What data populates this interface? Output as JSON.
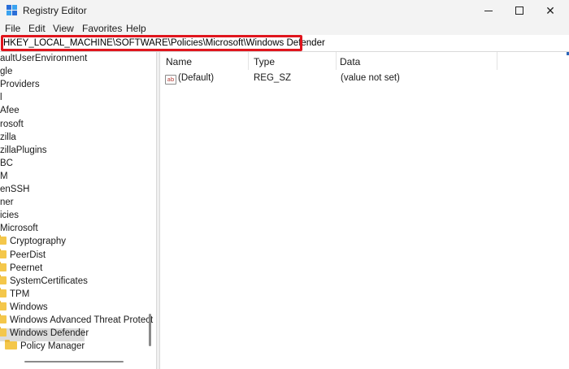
{
  "window": {
    "title": "Registry Editor",
    "minimize_glyph": "",
    "close_glyph": "✕"
  },
  "menu": [
    "File",
    "Edit",
    "View",
    "Favorites",
    "Help"
  ],
  "address": {
    "path": "HKEY_LOCAL_MACHINE\\SOFTWARE\\Policies\\Microsoft\\Windows Defender"
  },
  "tree": {
    "items": [
      {
        "label": "aultUserEnvironment",
        "folder": false
      },
      {
        "label": "gle",
        "folder": false
      },
      {
        "label": "Providers",
        "folder": false
      },
      {
        "label": "l",
        "folder": false
      },
      {
        "label": "Afee",
        "folder": false
      },
      {
        "label": "rosoft",
        "folder": false
      },
      {
        "label": "zilla",
        "folder": false
      },
      {
        "label": "zillaPlugins",
        "folder": false
      },
      {
        "label": "BC",
        "folder": false
      },
      {
        "label": "M",
        "folder": false
      },
      {
        "label": "enSSH",
        "folder": false
      },
      {
        "label": "ner",
        "folder": false
      },
      {
        "label": "icies",
        "folder": false
      },
      {
        "label": "Microsoft",
        "folder": false
      },
      {
        "label": "Cryptography",
        "folder": true
      },
      {
        "label": "PeerDist",
        "folder": true
      },
      {
        "label": "Peernet",
        "folder": true
      },
      {
        "label": "SystemCertificates",
        "folder": true
      },
      {
        "label": "TPM",
        "folder": true
      },
      {
        "label": "Windows",
        "folder": true
      },
      {
        "label": "Windows Advanced Threat Protect",
        "folder": true
      },
      {
        "label": "Windows Defender",
        "folder": true,
        "selected": true
      },
      {
        "label": "Policy Manager",
        "folder": true
      }
    ]
  },
  "values": {
    "columns": [
      "Name",
      "Type",
      "Data"
    ],
    "rows": [
      {
        "icon": "ab",
        "name": "(Default)",
        "type": "REG_SZ",
        "data": "(value not set)"
      }
    ]
  },
  "colors": {
    "highlight_border": "#e0151d",
    "selected_row": "#dcdcdc",
    "folder": "#f4c74b"
  }
}
